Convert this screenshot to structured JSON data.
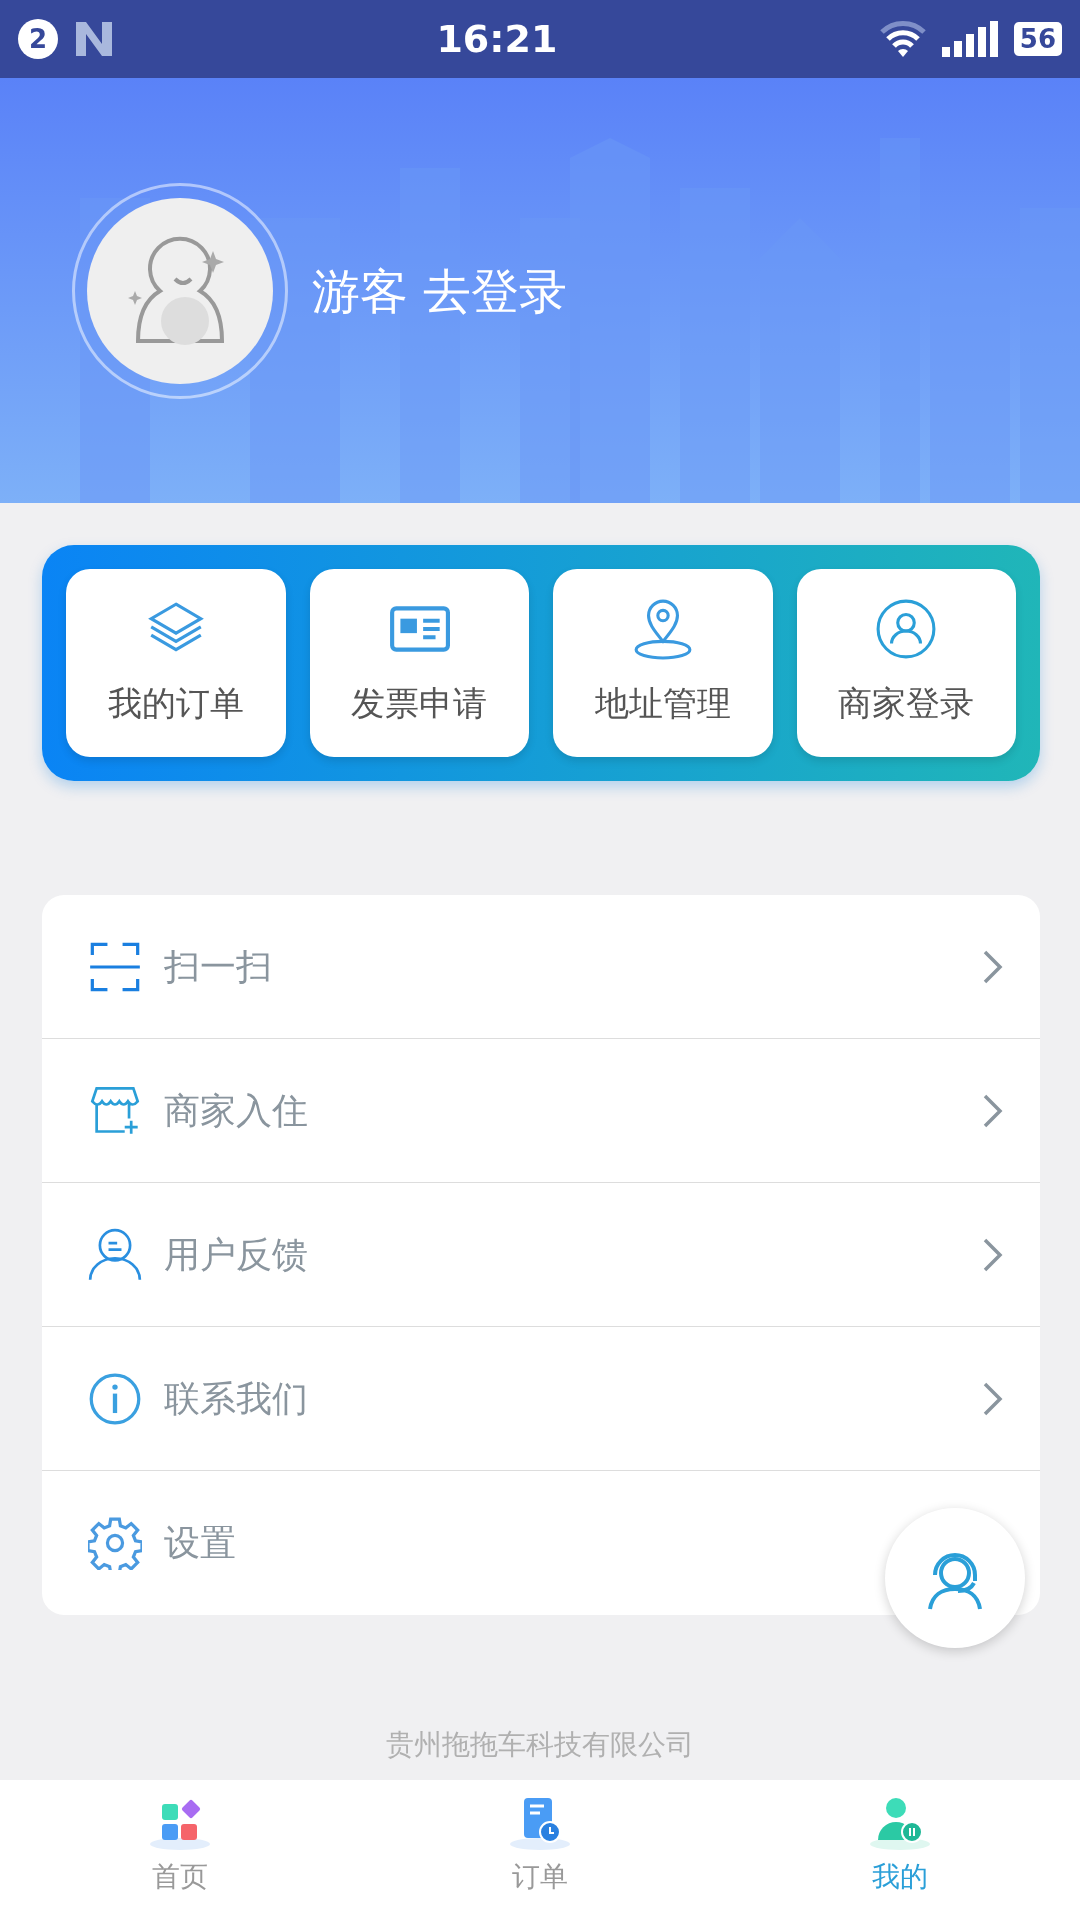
{
  "status_bar": {
    "notification_count": "2",
    "time": "16:21",
    "battery": "56"
  },
  "profile": {
    "name": "游客",
    "action": "去登录"
  },
  "quick_actions": [
    {
      "label": "我的订单"
    },
    {
      "label": "发票申请"
    },
    {
      "label": "地址管理"
    },
    {
      "label": "商家登录"
    }
  ],
  "menu": [
    {
      "label": "扫一扫",
      "arrow": true
    },
    {
      "label": "商家入住",
      "arrow": true
    },
    {
      "label": "用户反馈",
      "arrow": true
    },
    {
      "label": "联系我们",
      "arrow": true
    },
    {
      "label": "设置",
      "arrow": false
    }
  ],
  "footer": "贵州拖拖车科技有限公司",
  "tabs": [
    {
      "label": "首页",
      "selected": false
    },
    {
      "label": "订单",
      "selected": false
    },
    {
      "label": "我的",
      "selected": true
    }
  ]
}
